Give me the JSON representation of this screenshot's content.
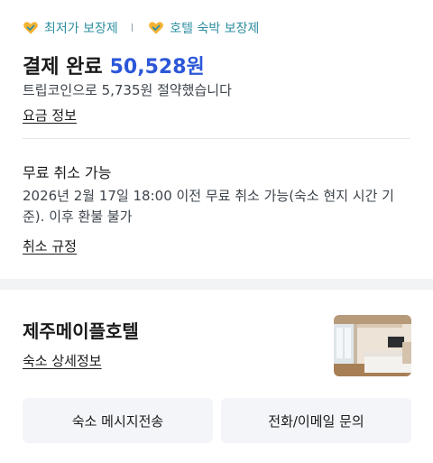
{
  "badges": [
    {
      "label": "최저가 보장제",
      "icon": "heart-check-icon"
    },
    {
      "label": "호텔 숙박 보장제",
      "icon": "heart-check-icon"
    }
  ],
  "badge_separator": "I",
  "payment": {
    "title": "결제 완료",
    "amount": "50,528원",
    "saving_text": "트립코인으로 5,735원 절약했습니다",
    "fee_link": "요금 정보"
  },
  "cancellation": {
    "title": "무료 취소 가능",
    "description": "2026년 2월 17일 18:00 이전 무료 취소 가능(숙소 현지 시간 기준). 이후 환불 불가",
    "policy_link": "취소 규정"
  },
  "hotel": {
    "name": "제주메이플호텔",
    "details_link": "숙소 상세정보"
  },
  "actions": {
    "message_button": "숙소 메시지전송",
    "contact_button": "전화/이메일 문의"
  },
  "colors": {
    "accent": "#2b57d8",
    "badge": "#2e8fa1",
    "badge_heart": "#f5b335"
  }
}
